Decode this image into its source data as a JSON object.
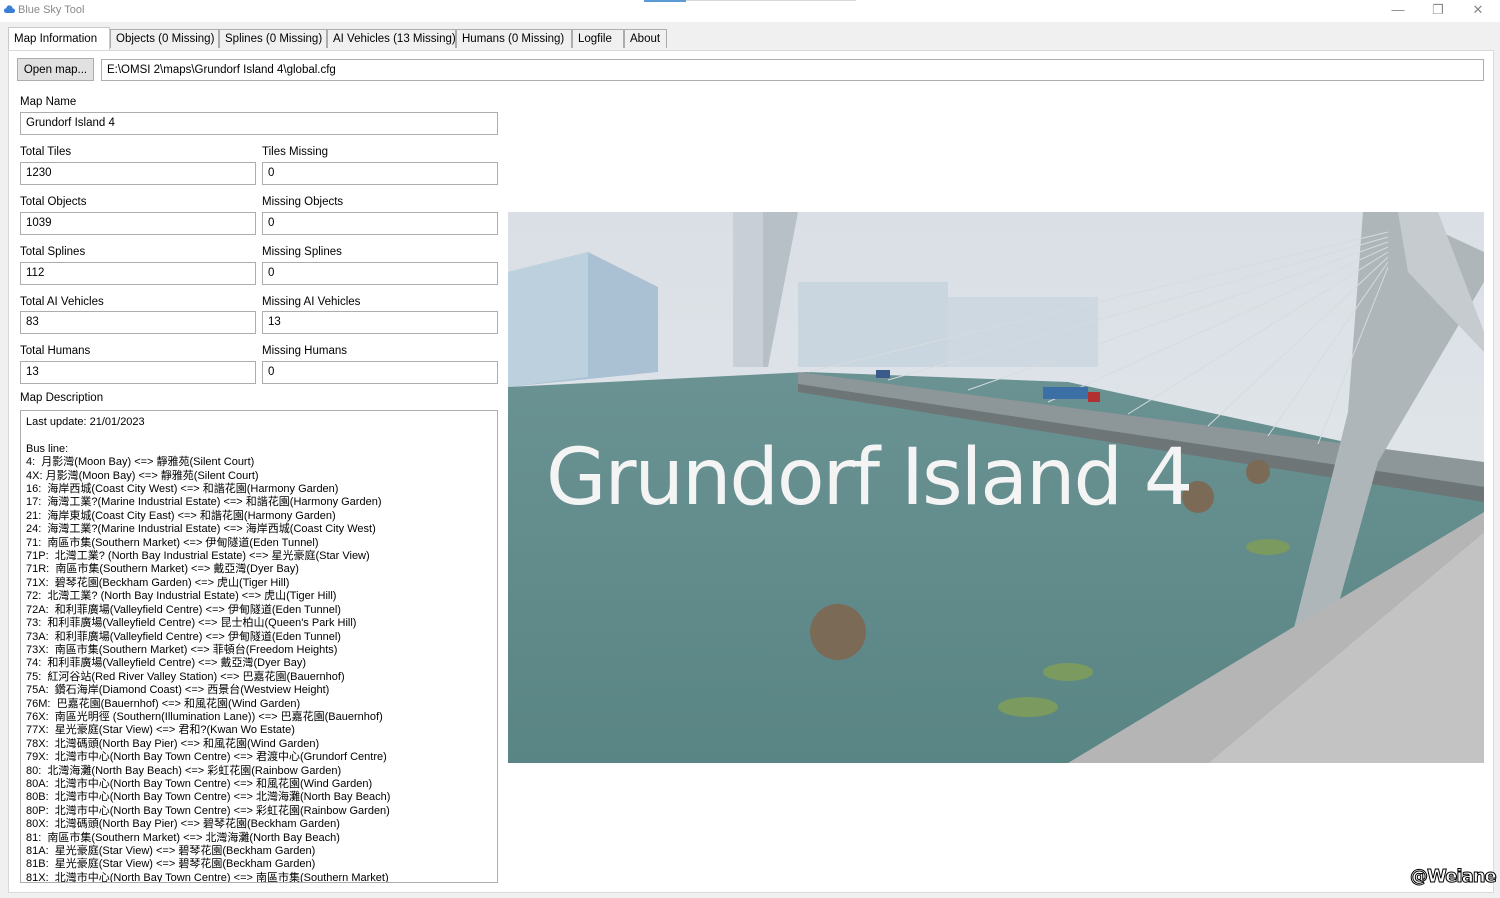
{
  "window": {
    "title": "Blue Sky Tool",
    "minimize": "—",
    "restore": "❐",
    "close": "✕"
  },
  "tabs": [
    {
      "label": "Map Information",
      "active": true
    },
    {
      "label": "Objects (0 Missing)"
    },
    {
      "label": "Splines (0 Missing)"
    },
    {
      "label": "AI Vehicles (13 Missing)"
    },
    {
      "label": "Humans (0 Missing)"
    },
    {
      "label": "Logfile"
    },
    {
      "label": "About"
    }
  ],
  "map_info": {
    "open_button": "Open map...",
    "path": "E:\\OMSI 2\\maps\\Grundorf Island 4\\global.cfg",
    "map_name_label": "Map Name",
    "map_name": "Grundorf Island 4",
    "fields": [
      {
        "label": "Total Tiles",
        "value": "1230"
      },
      {
        "label": "Tiles Missing",
        "value": "0"
      },
      {
        "label": "Total Objects",
        "value": "1039"
      },
      {
        "label": "Missing Objects",
        "value": "0"
      },
      {
        "label": "Total Splines",
        "value": "112"
      },
      {
        "label": "Missing Splines",
        "value": "0"
      },
      {
        "label": "Total AI Vehicles",
        "value": "83"
      },
      {
        "label": "Missing AI Vehicles",
        "value": "13"
      },
      {
        "label": "Total Humans",
        "value": "13"
      },
      {
        "label": "Missing Humans",
        "value": "0"
      }
    ],
    "description_label": "Map Description",
    "description": "Last update: 21/01/2023\n\nBus line:\n4:  月影灣(Moon Bay) <=> 靜雅苑(Silent Court)\n4X: 月影灣(Moon Bay) <=> 靜雅苑(Silent Court)\n16:  海岸西城(Coast City West) <=> 和諧花園(Harmony Garden)\n17:  海灣工業?(Marine Industrial Estate) <=> 和諧花園(Harmony Garden)\n21:  海岸東城(Coast City East) <=> 和諧花園(Harmony Garden)\n24:  海灣工業?(Marine Industrial Estate) <=> 海岸西城(Coast City West)\n71:  南區市集(Southern Market) <=> 伊甸隧道(Eden Tunnel)\n71P:  北灣工業? (North Bay Industrial Estate) <=> 星光豪庭(Star View)\n71R:  南區市集(Southern Market) <=> 戴亞灣(Dyer Bay)\n71X:  碧琴花園(Beckham Garden) <=> 虎山(Tiger Hill)\n72:  北灣工業? (North Bay Industrial Estate) <=> 虎山(Tiger Hill)\n72A:  和利菲廣場(Valleyfield Centre) <=> 伊甸隧道(Eden Tunnel)\n73:  和利菲廣場(Valleyfield Centre) <=> 昆士柏山(Queen's Park Hill)\n73A:  和利菲廣場(Valleyfield Centre) <=> 伊甸隧道(Eden Tunnel)\n73X:  南區市集(Southern Market) <=> 菲頓台(Freedom Heights)\n74:  和利菲廣場(Valleyfield Centre) <=> 戴亞灣(Dyer Bay)\n75:  紅河谷站(Red River Valley Station) <=> 巴嘉花園(Bauernhof)\n75A:  鑽石海岸(Diamond Coast) <=> 西景台(Westview Height)\n76M:  巴嘉花園(Bauernhof) <=> 和風花園(Wind Garden)\n76X:  南區光明徑 (Southern(Illumination Lane)) <=> 巴嘉花園(Bauernhof)\n77X:  星光豪庭(Star View) <=> 君和?(Kwan Wo Estate)\n78X:  北灣碼頭(North Bay Pier) <=> 和風花園(Wind Garden)\n79X:  北灣市中心(North Bay Town Centre) <=> 君渡中心(Grundorf Centre)\n80:  北灣海灘(North Bay Beach) <=> 彩虹花園(Rainbow Garden)\n80A:  北灣市中心(North Bay Town Centre) <=> 和風花園(Wind Garden)\n80B:  北灣市中心(North Bay Town Centre) <=> 北灣海灘(North Bay Beach)\n80P:  北灣市中心(North Bay Town Centre) <=> 彩虹花園(Rainbow Garden)\n80X:  北灣碼頭(North Bay Pier) <=> 碧琴花園(Beckham Garden)\n81:  南區市集(Southern Market) <=> 北灣海灘(North Bay Beach)\n81A:  星光豪庭(Star View) <=> 碧琴花園(Beckham Garden)\n81B:  星光豪庭(Star View) <=> 碧琴花園(Beckham Garden)\n81X:  北灣市中心(North Bay Town Centre) <=> 南區市集(Southern Market)",
    "preview_text": "Grundorf Island 4"
  },
  "watermark": "@Weiane",
  "colors": {
    "accent": "#5b9bd5",
    "water": "#5f8a8a",
    "sky": "#dde3e8"
  }
}
